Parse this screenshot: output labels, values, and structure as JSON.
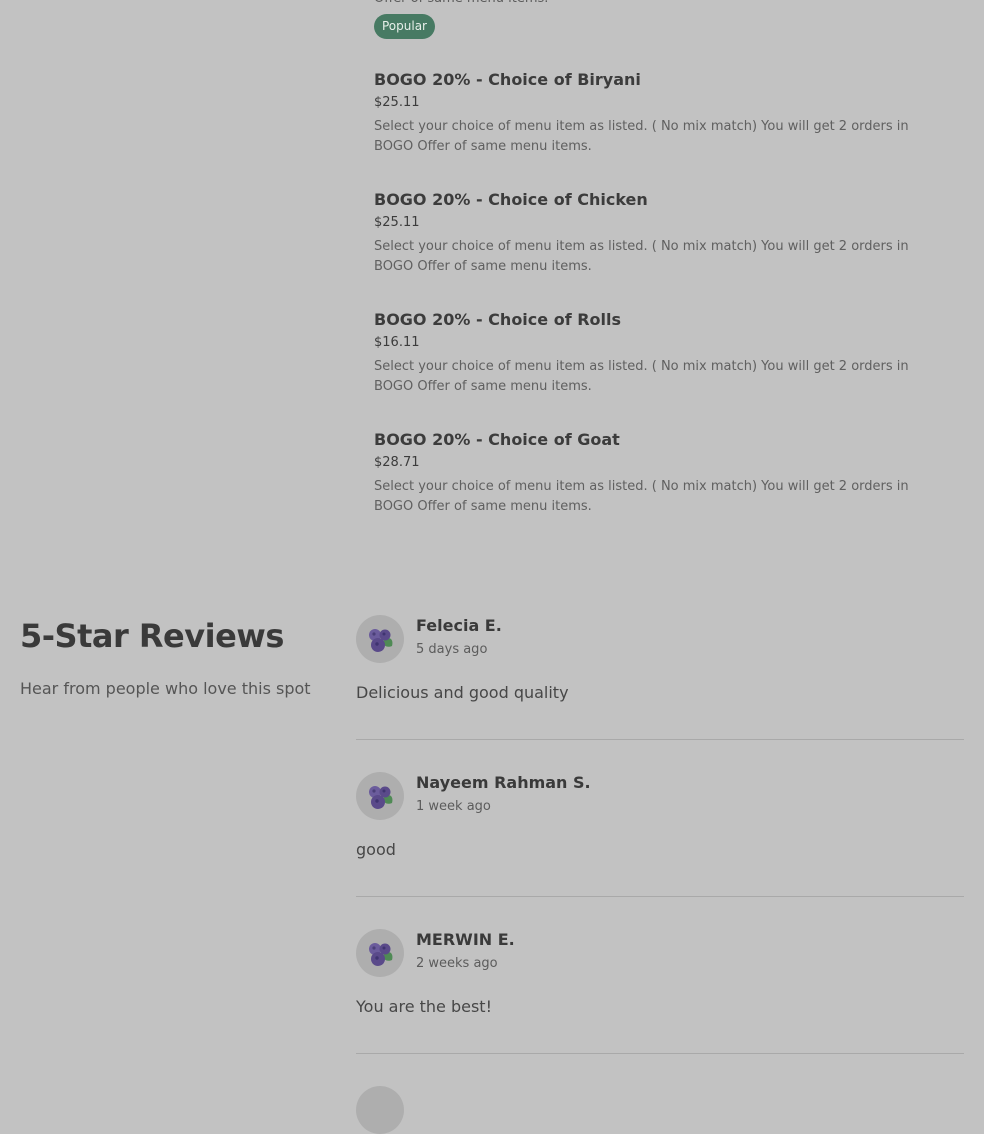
{
  "menu": {
    "cut_description": "Offer of same menu items.",
    "popular_badge": "Popular",
    "items": [
      {
        "title": "BOGO 20% - Choice of Biryani",
        "price": "$25.11",
        "description": "Select your choice of menu item as listed. ( No mix match) You will get 2 orders in BOGO Offer of same menu items."
      },
      {
        "title": "BOGO 20% - Choice of Chicken",
        "price": "$25.11",
        "description": "Select your choice of menu item as listed. ( No mix match) You will get 2 orders in BOGO Offer of same menu items."
      },
      {
        "title": "BOGO 20% - Choice of Rolls",
        "price": "$16.11",
        "description": "Select your choice of menu item as listed. ( No mix match) You will get 2 orders in BOGO Offer of same menu items."
      },
      {
        "title": "BOGO 20% - Choice of Goat",
        "price": "$28.71",
        "description": "Select your choice of menu item as listed. ( No mix match) You will get 2 orders in BOGO Offer of same menu items."
      }
    ]
  },
  "reviews": {
    "title": "5-Star Reviews",
    "subtitle": "Hear from people who love this spot",
    "avatar_icon": "blueberry-icon",
    "items": [
      {
        "name": "Felecia E.",
        "time": "5 days ago",
        "text": "Delicious and good quality"
      },
      {
        "name": "Nayeem Rahman S.",
        "time": "1 week ago",
        "text": "good"
      },
      {
        "name": "MERWIN E.",
        "time": "2 weeks ago",
        "text": "You are the best!"
      }
    ]
  },
  "colors": {
    "background": "#c2c2c2",
    "badge": "#477a63",
    "avatar_berry": "#5a4a8a",
    "avatar_leaf": "#4f8a55"
  }
}
